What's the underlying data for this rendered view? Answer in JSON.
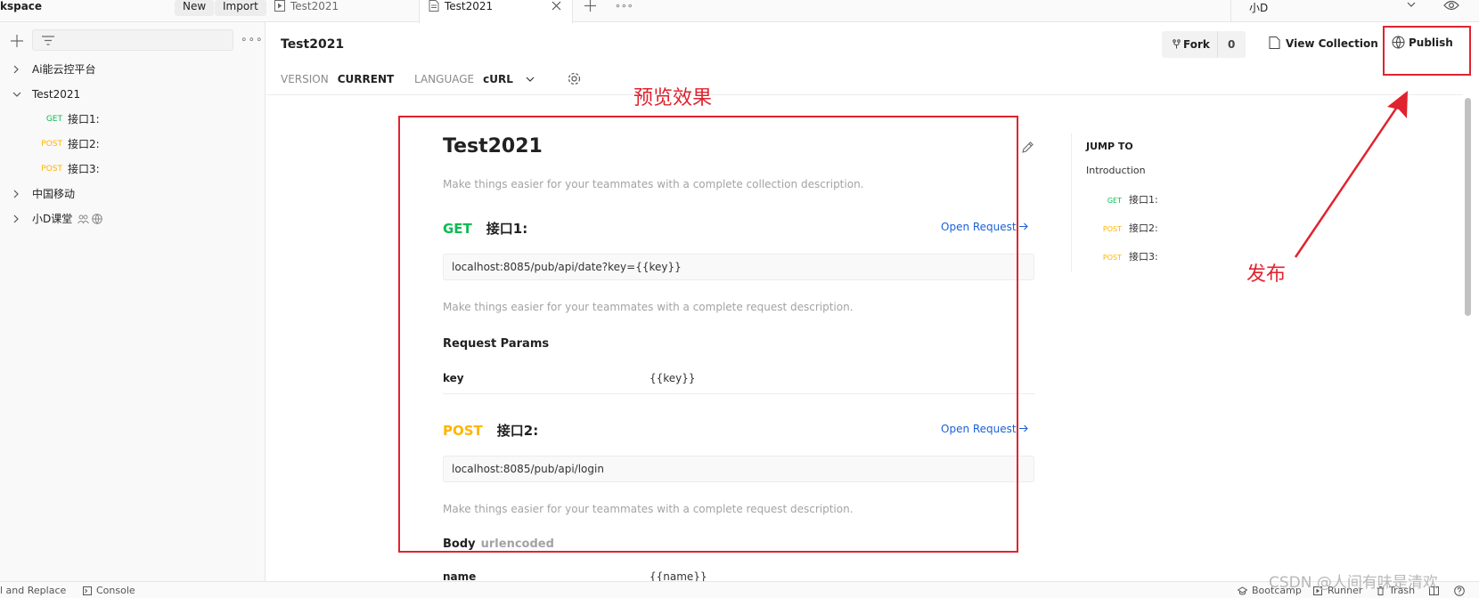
{
  "topbar": {
    "workspace_title": "kspace",
    "new_label": "New",
    "import_label": "Import",
    "tabs": [
      {
        "label": "Test2021"
      },
      {
        "label": "Test2021"
      }
    ],
    "more_glyph": "∘∘∘",
    "env_label": "小D"
  },
  "sidebar": {
    "more_glyph": "∘∘∘",
    "tree": [
      {
        "label": "Ai能云控平台"
      },
      {
        "label": "Test2021"
      },
      {
        "method": "GET",
        "label": "接口1:"
      },
      {
        "method": "POST",
        "label": "接口2:"
      },
      {
        "method": "POST",
        "label": "接口3:"
      },
      {
        "label": "中国移动"
      },
      {
        "label": "小D课堂"
      }
    ]
  },
  "header": {
    "title": "Test2021",
    "fork_label": "Fork",
    "fork_count": "0",
    "view_collection_label": "View Collection",
    "publish_label": "Publish",
    "version_key": "VERSION",
    "version_value": "CURRENT",
    "language_key": "LANGUAGE",
    "language_value": "cURL"
  },
  "doc": {
    "title": "Test2021",
    "collection_desc": "Make things easier for your teammates with a complete collection description.",
    "requests": [
      {
        "method": "GET",
        "name": "接口1:",
        "open_label": "Open Request",
        "url": "localhost:8085/pub/api/date?key={{key}}",
        "desc": "Make things easier for your teammates with a complete request description.",
        "section_title": "Request Params",
        "param_key": "key",
        "param_value": "{{key}}"
      },
      {
        "method": "POST",
        "name": "接口2:",
        "open_label": "Open Request",
        "url": "localhost:8085/pub/api/login",
        "desc": "Make things easier for your teammates with a complete request description.",
        "section_title": "Body",
        "section_sub": "urlencoded",
        "param_key": "name",
        "param_value": "{{name}}"
      }
    ]
  },
  "jump_to": {
    "heading": "JUMP TO",
    "intro": "Introduction",
    "items": [
      {
        "method": "GET",
        "label": "接口1:"
      },
      {
        "method": "POST",
        "label": "接口2:"
      },
      {
        "method": "POST",
        "label": "接口3:"
      }
    ]
  },
  "annotations": {
    "preview": "预览效果",
    "publish": "发布"
  },
  "statusbar": {
    "find_replace": "l and Replace",
    "console": "Console",
    "bootcamp": "Bootcamp",
    "runner": "Runner",
    "trash": "Trash"
  },
  "watermark": "CSDN @人间有味是清欢",
  "colors": {
    "get": "#0cbb52",
    "post": "#ffb400",
    "link": "#1c61d7",
    "annotation": "#e0232f"
  }
}
